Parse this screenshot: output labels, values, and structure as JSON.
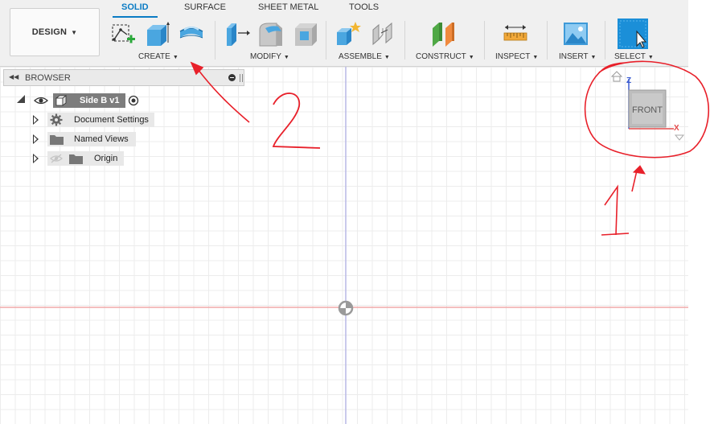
{
  "workspace": {
    "label": "DESIGN"
  },
  "tabs": [
    {
      "label": "SOLID",
      "active": true
    },
    {
      "label": "SURFACE",
      "active": false
    },
    {
      "label": "SHEET METAL",
      "active": false
    },
    {
      "label": "TOOLS",
      "active": false
    }
  ],
  "toolbar_groups": [
    {
      "label": "CREATE",
      "tools": [
        "create-sketch-icon",
        "extrude-icon",
        "revolve-icon"
      ]
    },
    {
      "label": "MODIFY",
      "tools": [
        "press-pull-icon",
        "fillet-icon",
        "shell-icon"
      ]
    },
    {
      "label": "ASSEMBLE",
      "tools": [
        "new-component-icon",
        "joint-icon"
      ]
    },
    {
      "label": "CONSTRUCT",
      "tools": [
        "offset-plane-icon"
      ]
    },
    {
      "label": "INSPECT",
      "tools": [
        "measure-icon"
      ]
    },
    {
      "label": "INSERT",
      "tools": [
        "insert-image-icon"
      ]
    },
    {
      "label": "SELECT",
      "tools": [
        "select-icon"
      ]
    }
  ],
  "browser": {
    "title": "BROWSER",
    "component": "Side B v1",
    "nodes": [
      {
        "label": "Document Settings",
        "icon": "gear-icon"
      },
      {
        "label": "Named Views",
        "icon": "folder-icon"
      },
      {
        "label": "Origin",
        "icon": "folder-icon",
        "hidden": true
      }
    ]
  },
  "viewcube": {
    "face": "FRONT",
    "axis_z": "Z",
    "axis_x": "X"
  },
  "annotations": {
    "label_1": "1",
    "label_2": "2",
    "color": "#e8202a"
  },
  "colors": {
    "accent": "#0a7bc4",
    "x_axis": "#f0a0a0",
    "z_axis": "#b0b0e0",
    "annotation": "#e8202a"
  }
}
